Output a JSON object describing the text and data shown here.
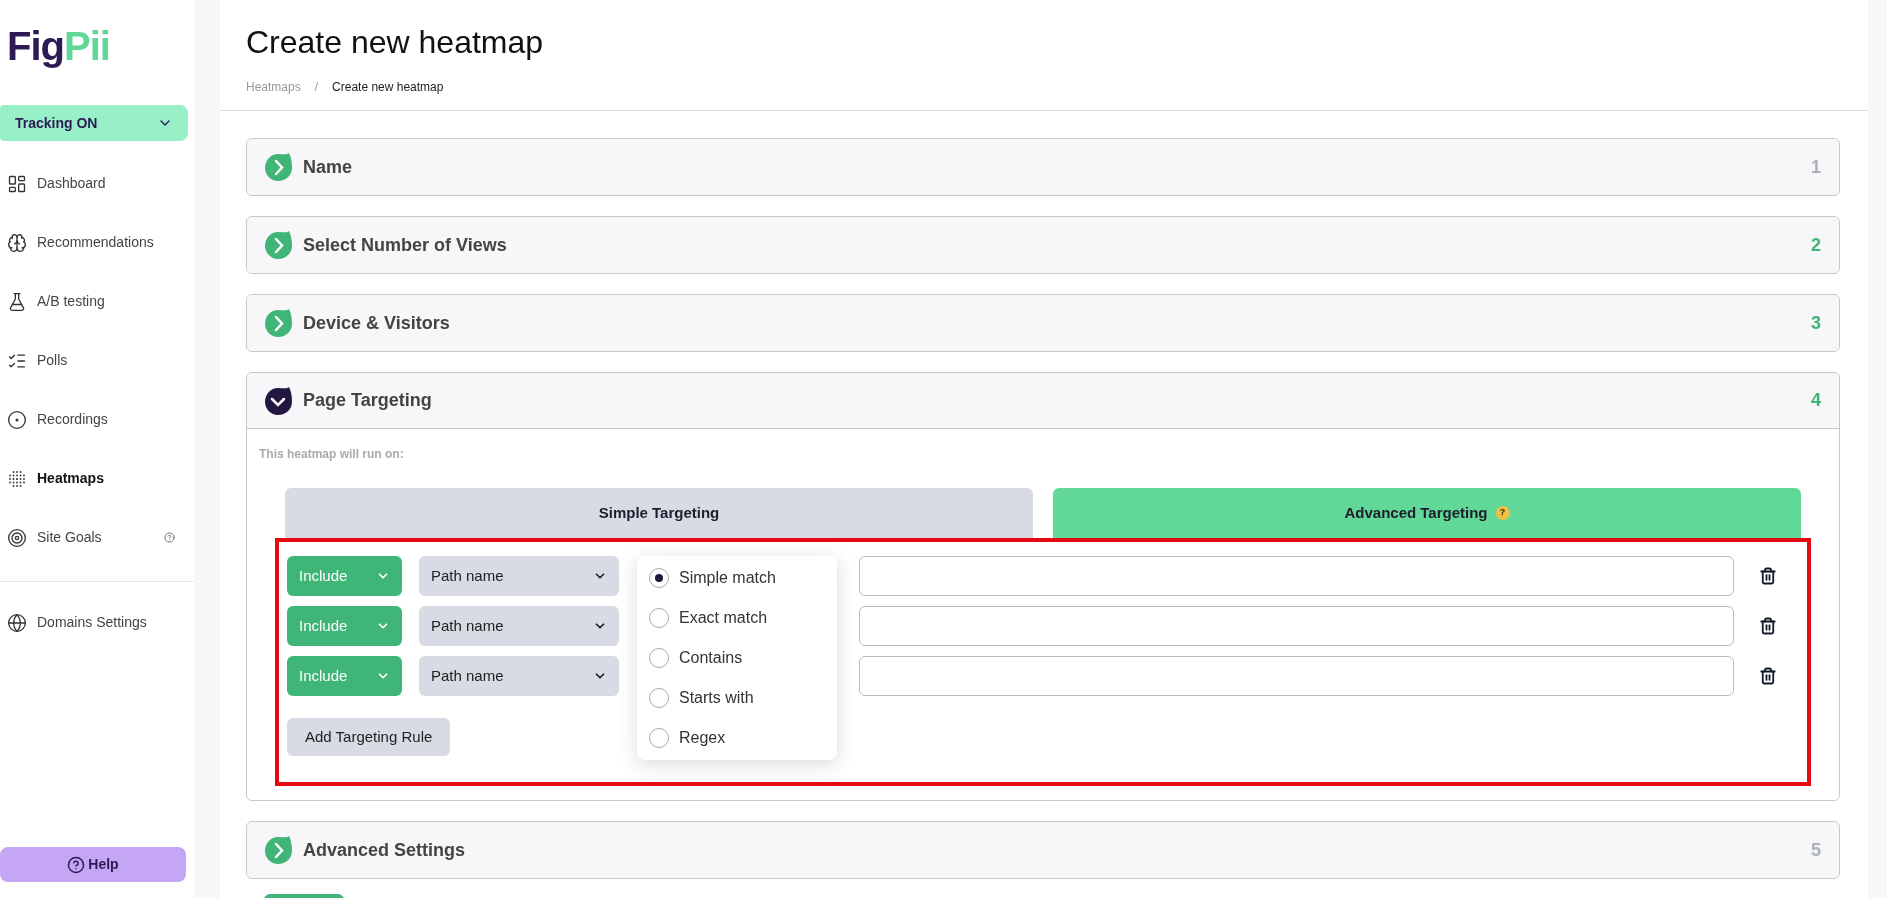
{
  "sidebar": {
    "logo": {
      "part_1": "Fig",
      "part_2": "Pii"
    },
    "tracking": {
      "label": "Tracking ON"
    },
    "items": [
      {
        "label": "Dashboard",
        "selected": false,
        "help": false
      },
      {
        "label": "Recommendations",
        "selected": false,
        "help": false
      },
      {
        "label": "A/B testing",
        "selected": false,
        "help": false
      },
      {
        "label": "Polls",
        "selected": false,
        "help": false
      },
      {
        "label": "Recordings",
        "selected": false,
        "help": false
      },
      {
        "label": "Heatmaps",
        "selected": true,
        "help": false
      },
      {
        "label": "Site Goals",
        "selected": false,
        "help": true
      }
    ],
    "footer_items": [
      {
        "label": "Domains Settings",
        "selected": false
      }
    ],
    "help_button": {
      "label": "Help"
    }
  },
  "header": {
    "title": "Create new heatmap",
    "breadcrumb": {
      "separator": "/",
      "items": [
        "Heatmaps",
        "Create new heatmap"
      ]
    }
  },
  "steps": [
    {
      "title": "Name",
      "number": "1",
      "done": false,
      "expanded": false
    },
    {
      "title": "Select Number of Views",
      "number": "2",
      "done": true,
      "expanded": false
    },
    {
      "title": "Device & Visitors",
      "number": "3",
      "done": true,
      "expanded": false
    },
    {
      "title": "Page Targeting",
      "number": "4",
      "done": true,
      "expanded": true
    },
    {
      "title": "Advanced Settings",
      "number": "5",
      "done": false,
      "expanded": false
    }
  ],
  "page_targeting": {
    "intro": "This heatmap will run on:",
    "tabs": [
      {
        "label": "Simple Targeting",
        "selected": false
      },
      {
        "label": "Advanced Targeting",
        "selected": true,
        "help_badge": "?"
      }
    ],
    "highlighted": true,
    "rules": [
      {
        "mode": "Include",
        "field": "Path name"
      },
      {
        "mode": "Include",
        "field": "Path name"
      },
      {
        "mode": "Include",
        "field": "Path name"
      }
    ],
    "match_menu": {
      "options": [
        {
          "label": "Simple match",
          "selected": true
        },
        {
          "label": "Exact match",
          "selected": false
        },
        {
          "label": "Contains",
          "selected": false
        },
        {
          "label": "Starts with",
          "selected": false
        },
        {
          "label": "Regex",
          "selected": false
        }
      ]
    },
    "add_rule_button": {
      "label": "Add Targeting Rule"
    }
  }
}
